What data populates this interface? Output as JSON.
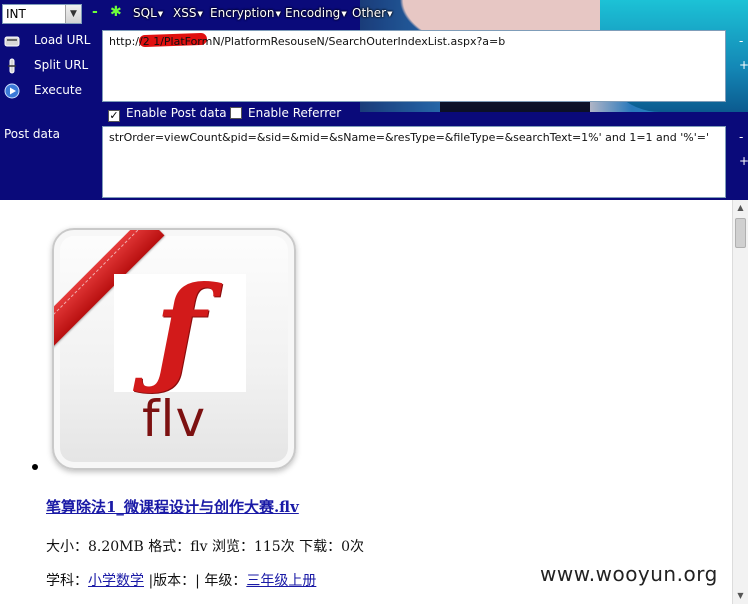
{
  "toolbar": {
    "type_select": "INT",
    "minus": "-",
    "plus": "+",
    "menus": [
      {
        "label": "SQL"
      },
      {
        "label": "XSS"
      },
      {
        "label": "Encryption"
      },
      {
        "label": "Encoding"
      },
      {
        "label": "Other"
      }
    ],
    "actions": {
      "load_url": "Load URL",
      "split_url": "Split URL",
      "execute": "Execute"
    },
    "url_value": "http://2          1/PlatFormN/PlatformResouseN/SearchOuterIndexList.aspx?a=b",
    "enable_post_label": "Enable Post data",
    "enable_post_checked": true,
    "enable_referrer_label": "Enable Referrer",
    "enable_referrer_checked": false,
    "post_label": "Post data",
    "post_value": "strOrder=viewCount&pid=&sid=&mid=&sName=&resType=&fileType=&searchText=1%' and 1=1 and '%'='",
    "side_minus": "-",
    "side_plus": "+"
  },
  "page": {
    "icon_caption": "flv",
    "file_title": "笔算除法1_微课程设计与创作大赛.flv",
    "meta_line": "大小：8.20MB 格式：flv 浏览：115次 下载：0次",
    "subject_label": "学科：",
    "subject_value": "小学数学",
    "edition_label": "|版本：| 年级：",
    "grade_value": "三年级上册"
  },
  "watermark": "www.wooyun.org"
}
